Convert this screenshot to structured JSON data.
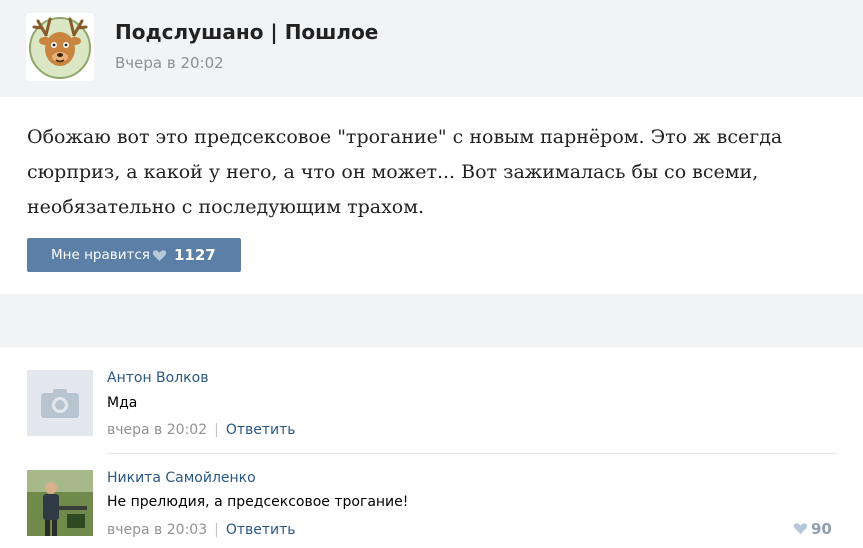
{
  "colors": {
    "accent": "#5b7fa6",
    "link": "#2a5885",
    "muted": "#8f8f8f",
    "header_bg": "#f2f3f5"
  },
  "post": {
    "group_name": "Подслушано | Пошлое",
    "time": "Вчера в 20:02",
    "avatar_icon": "deer-mascot-icon",
    "text": "Обожаю вот это предсексовое \"трогание\" с новым парнёром. Это ж всегда сюрприз, а какой у него, а что он может... Вот зажималась бы со всеми, необязательно с последующим трахом.",
    "like_label": "Мне нравится",
    "like_count": "1127"
  },
  "comments": [
    {
      "author": "Антон Волков",
      "text": "Мда",
      "time": "вчера в 20:02",
      "reply_label": "Ответить",
      "avatar_icon": "camera-placeholder-icon"
    },
    {
      "author": "Никита Самойленко",
      "text": "Не прелюдия, а предсексовое трогание!",
      "time": "вчера в 20:03",
      "reply_label": "Ответить",
      "likes": "90",
      "avatar_icon": "user-photo"
    }
  ]
}
